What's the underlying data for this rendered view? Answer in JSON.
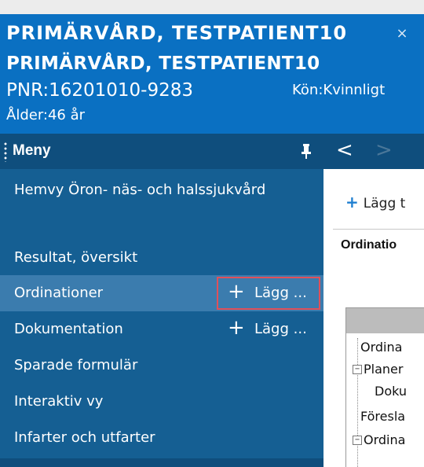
{
  "patient_header": {
    "tab_title": "PRIMÄRVÅRD,  TESTPATIENT10",
    "close_glyph": "×",
    "name": "PRIMÄRVÅRD, TESTPATIENT10",
    "pnr": "PNR:16201010-9283",
    "kon": "Kön:Kvinnligt",
    "alder": "Ålder:46 år",
    "background_color": "#0a70c2"
  },
  "menu": {
    "title": "Meny",
    "pin_icon": "pin-icon",
    "items": [
      {
        "label": "Hemvy Öron- näs- och halssjukvård",
        "selected": false
      },
      {
        "label": "",
        "selected": false
      },
      {
        "label": "Resultat, översikt",
        "selected": false
      },
      {
        "label": "Ordinationer",
        "selected": true,
        "add_label": "Lägg ..."
      },
      {
        "label": "Dokumentation",
        "selected": false,
        "add_label": "Lägg ..."
      },
      {
        "label": "Sparade formulär",
        "selected": false
      },
      {
        "label": "Interaktiv vy",
        "selected": false
      },
      {
        "label": "Infarter och utfarter",
        "selected": false
      }
    ],
    "plus_glyph": "+",
    "colors": {
      "bar": "#0f4e7d",
      "sidebar": "#155f93",
      "selected": "#3b7cae",
      "highlight_border": "#e0505a"
    }
  },
  "nav": {
    "back_glyph": "<",
    "forward_glyph": ">"
  },
  "content": {
    "add_label": "Lägg t",
    "plus_glyph": "+",
    "panel_title": "Ordinatio",
    "tree": [
      {
        "label": "Ordina",
        "expander": ""
      },
      {
        "label": "Planer",
        "expander": "−"
      },
      {
        "label": "Doku",
        "expander": ""
      },
      {
        "label": "Föresla",
        "expander": ""
      },
      {
        "label": "Ordina",
        "expander": "−"
      }
    ]
  }
}
